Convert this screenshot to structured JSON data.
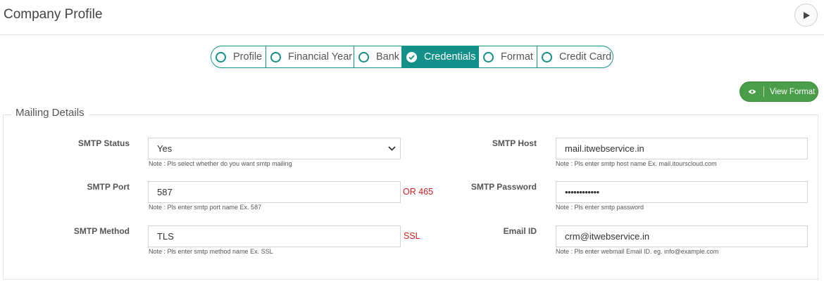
{
  "header": {
    "title": "Company Profile",
    "action_icon": "play-icon"
  },
  "tabs": [
    {
      "label": "Profile",
      "active": false
    },
    {
      "label": "Financial Year",
      "active": false
    },
    {
      "label": "Bank",
      "active": false
    },
    {
      "label": "Credentials",
      "active": true
    },
    {
      "label": "Format",
      "active": false
    },
    {
      "label": "Credit Card",
      "active": false
    }
  ],
  "view_format": {
    "label": "View Format",
    "icon": "eye-icon"
  },
  "section": {
    "title": "Mailing Details"
  },
  "fields": {
    "smtp_status": {
      "label": "SMTP Status",
      "value": "Yes",
      "note": "Note : Pls select whether do you want smtp mailing"
    },
    "smtp_host": {
      "label": "SMTP Host",
      "value": "mail.itwebservice.in",
      "note": "Note : Pls enter smtp host name Ex. mail.itourscloud.com"
    },
    "smtp_port": {
      "label": "SMTP Port",
      "value": "587",
      "alt": "OR 465",
      "note": "Note : Pls enter smtp port name Ex. 587"
    },
    "smtp_password": {
      "label": "SMTP Password",
      "value": "••••••••••••",
      "note": "Note : Pls enter smtp password"
    },
    "smtp_method": {
      "label": "SMTP Method",
      "value": "TLS",
      "alt": "SSL",
      "note": "Note : Pls enter smtp method name Ex. SSL"
    },
    "email_id": {
      "label": "Email ID",
      "value": "crm@itwebservice.in",
      "note": "Note : Pls enter webmail Email ID. eg. info@example.com"
    }
  },
  "colors": {
    "accent": "#13908a",
    "button_green": "#4a9e4a",
    "alt_red": "#cc1f1f"
  }
}
